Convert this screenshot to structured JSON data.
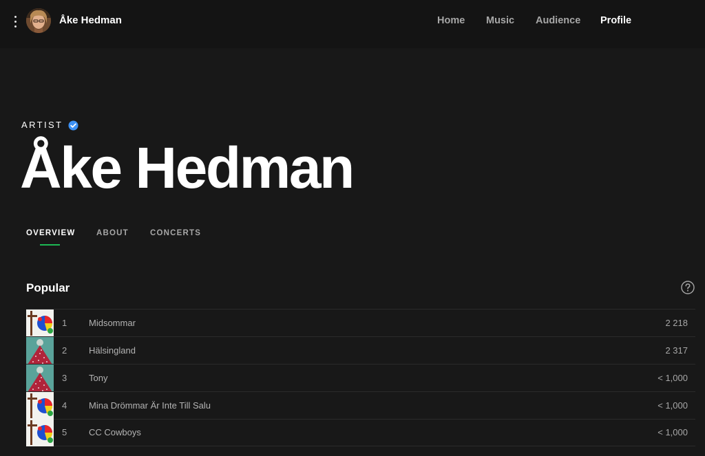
{
  "header": {
    "artist_name": "Åke Hedman",
    "nav": [
      "Home",
      "Music",
      "Audience",
      "Profile"
    ],
    "active_nav": "Profile"
  },
  "hero": {
    "label": "ARTIST",
    "name": "Åke Hedman",
    "verified_color": "#3d91f4"
  },
  "tabs": [
    "OVERVIEW",
    "ABOUT",
    "CONCERTS"
  ],
  "active_tab": "OVERVIEW",
  "accent_color": "#1db954",
  "popular": {
    "title": "Popular",
    "tracks": [
      {
        "rank": "1",
        "title": "Midsommar",
        "plays": "2 218",
        "artwork": "colorful-figure-artwork"
      },
      {
        "rank": "2",
        "title": "Hälsingland",
        "plays": "2 317",
        "artwork": "red-dress-artwork"
      },
      {
        "rank": "3",
        "title": "Tony",
        "plays": "< 1,000",
        "artwork": "red-dress-artwork"
      },
      {
        "rank": "4",
        "title": "Mina Drömmar Är Inte Till Salu",
        "plays": "< 1,000",
        "artwork": "colorful-figure-artwork"
      },
      {
        "rank": "5",
        "title": "CC Cowboys",
        "plays": "< 1,000",
        "artwork": "colorful-figure-artwork"
      }
    ]
  }
}
